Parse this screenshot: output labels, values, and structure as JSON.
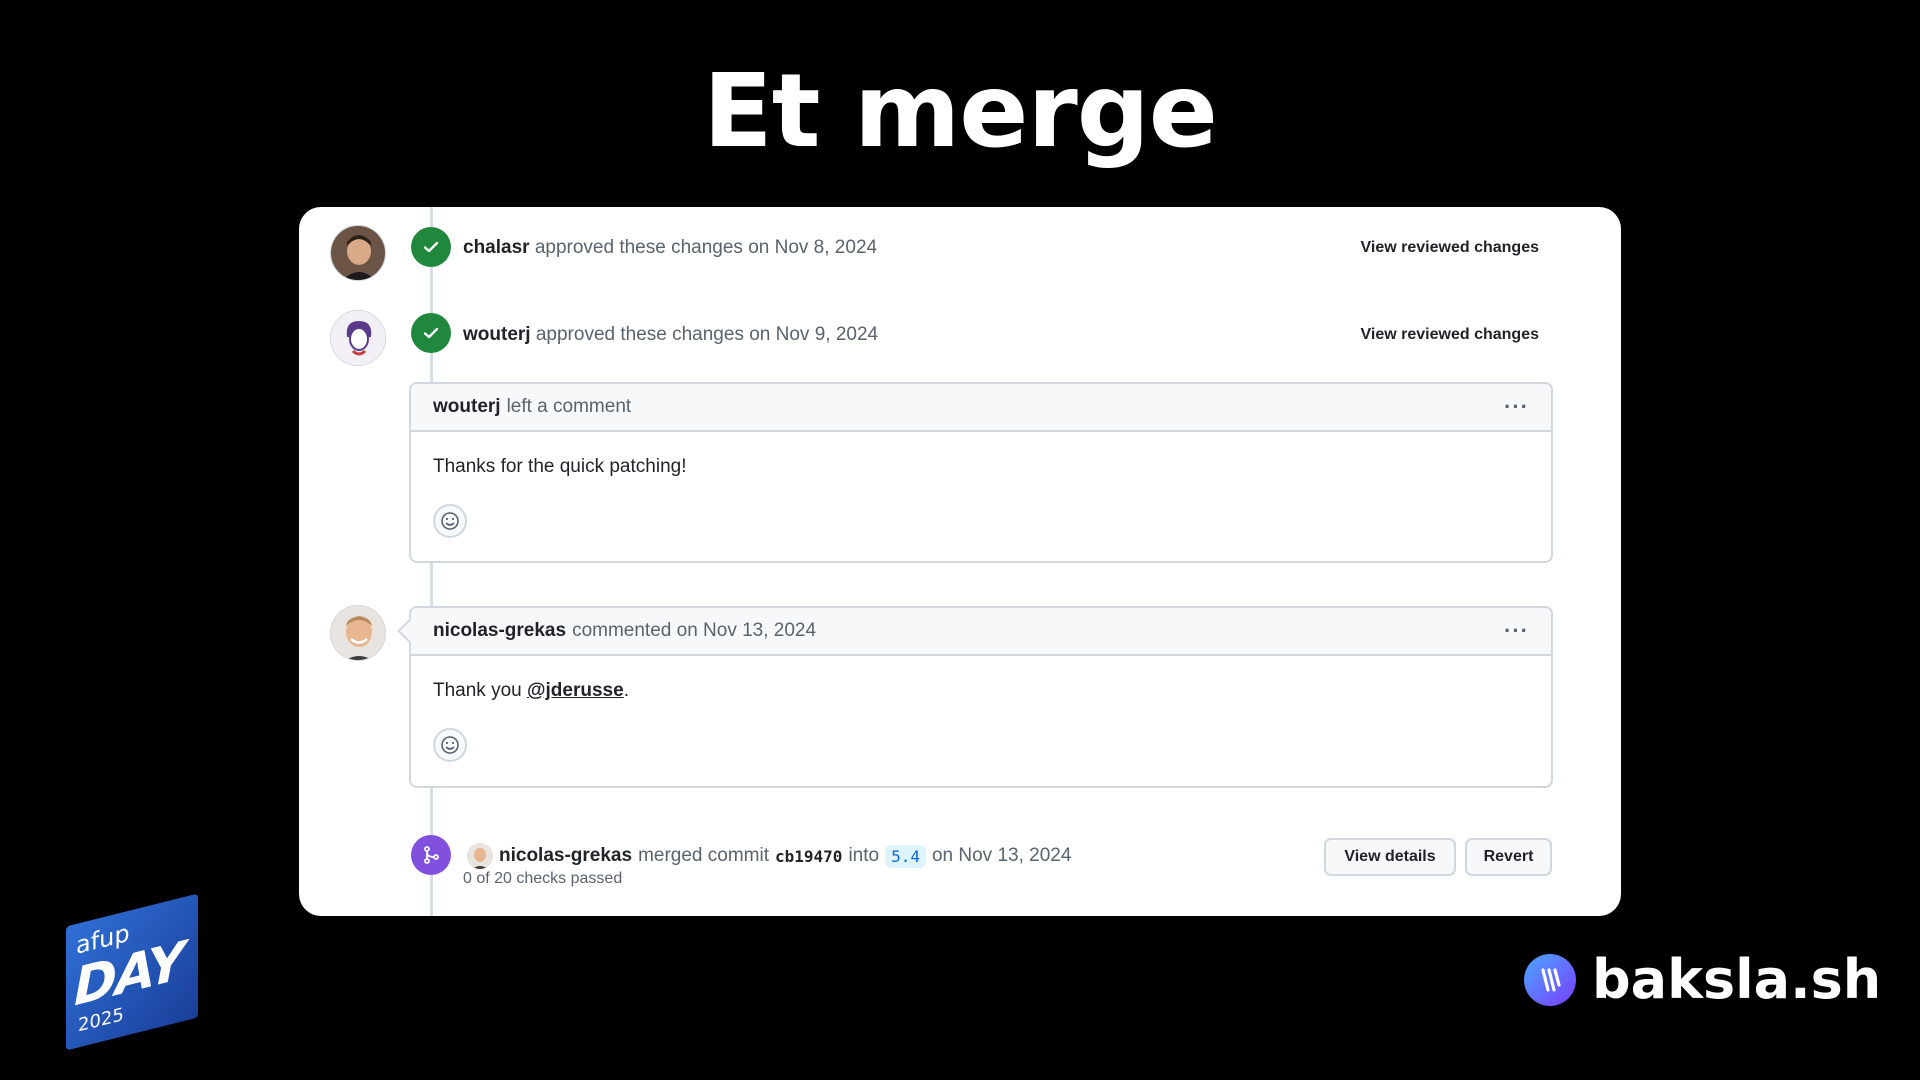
{
  "slide": {
    "title": "Et merge"
  },
  "events": [
    {
      "user": "chalasr",
      "action": "approved these changes on Nov 8, 2024",
      "link": "View reviewed changes"
    },
    {
      "user": "wouterj",
      "action": "approved these changes on Nov 9, 2024",
      "link": "View reviewed changes"
    }
  ],
  "comments": [
    {
      "user": "wouterj",
      "meta": "left a comment",
      "body": "Thanks for the quick patching!"
    },
    {
      "user": "nicolas-grekas",
      "meta": "commented on Nov 13, 2024",
      "body_prefix": "Thank you ",
      "mention": "@jderusse",
      "body_suffix": "."
    }
  ],
  "merge": {
    "user": "nicolas-grekas",
    "action": "merged commit",
    "commit": "cb19470",
    "into": "into",
    "branch": "5.4",
    "date": "on Nov 13, 2024",
    "checks": "0 of 20 checks passed",
    "details_label": "View details",
    "revert_label": "Revert"
  },
  "logos": {
    "afup_small": "afup",
    "afup_big": "DAY",
    "afup_year": "2025",
    "baksla": "baksla.sh"
  },
  "colors": {
    "approved": "#1f883d",
    "merged": "#8250df",
    "link": "#0969da"
  }
}
